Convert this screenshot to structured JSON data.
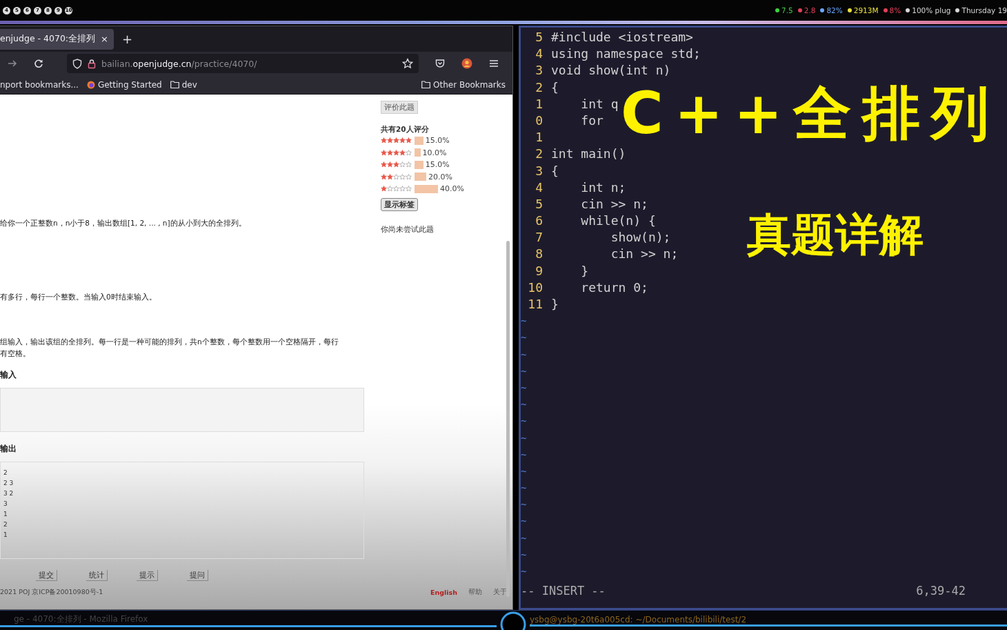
{
  "top_bar": {
    "workspaces": [
      "4",
      "5",
      "6",
      "7",
      "8",
      "9",
      "10"
    ],
    "status": [
      {
        "text": "7.5",
        "color": "#3fd13f"
      },
      {
        "text": "2.8",
        "color": "#e0405a"
      },
      {
        "text": "82%",
        "color": "#6aa8ff"
      },
      {
        "text": "2913M",
        "color": "#e8e040"
      },
      {
        "text": "8%",
        "color": "#e0405a"
      },
      {
        "text": "100% plug",
        "color": "#d8d8d8"
      },
      {
        "text": "Thursday 19",
        "color": "#d8d8d8"
      }
    ]
  },
  "browser": {
    "tab": {
      "title": "enjudge - 4070:全排列",
      "close": "×",
      "selected": true
    },
    "new_tab": "+",
    "url": {
      "host_prefix": "bailian.",
      "host": "openjudge.cn",
      "path": "/practice/4070/"
    },
    "bookmarks": [
      {
        "kind": "plain",
        "label": "nport bookmarks..."
      },
      {
        "kind": "firefox",
        "label": "Getting Started"
      },
      {
        "kind": "folder",
        "label": "dev"
      }
    ],
    "other_bookmarks": "Other Bookmarks",
    "problem": {
      "description": "给你一个正整数n，n小于8，输出数组[1, 2, ... , n]的从小到大的全排列。",
      "input": "有多行，每行一个整数。当输入0时结束输入。",
      "output": [
        "组输入，输出该组的全排列。每一行是一种可能的排列，共n个整数，每个整数用一个空格隔开，每行",
        "有空格。"
      ],
      "sample_input_heading": "输入",
      "sample_output_heading": "输出",
      "sample_output": [
        "2",
        "2 3",
        "3 2",
        "3",
        "1",
        "2",
        "1"
      ],
      "buttons": [
        "提交",
        "统计",
        "提示",
        "提问"
      ],
      "footer": "2021 POJ 京ICP备20010980号-1",
      "footer_links": [
        {
          "text": "English",
          "kind": "lang"
        },
        {
          "text": "帮助",
          "kind": "plain"
        },
        {
          "text": "关于",
          "kind": "plain"
        }
      ]
    },
    "sidebar": {
      "rate_button": "评价此题",
      "rating_title": "共有20人评分",
      "ratings": [
        {
          "stars": 5,
          "percent": "15.0%"
        },
        {
          "stars": 4,
          "percent": "10.0%"
        },
        {
          "stars": 3,
          "percent": "15.0%"
        },
        {
          "stars": 2,
          "percent": "20.0%"
        },
        {
          "stars": 1,
          "percent": "40.0%"
        }
      ],
      "tags_button": "显示标签",
      "status": "你尚未尝试此题"
    }
  },
  "editor": {
    "lines": [
      {
        "num": "5",
        "text": "#include <iostream>"
      },
      {
        "num": "4",
        "text": "using namespace std;"
      },
      {
        "num": "3",
        "text": "void show(int n)"
      },
      {
        "num": "2",
        "text": "{"
      },
      {
        "num": "1",
        "text": "    int q"
      },
      {
        "num": "0",
        "text": "    for"
      },
      {
        "num": "1"
      },
      {
        "num": "2",
        "text": "int main()"
      },
      {
        "num": "3",
        "text": "{"
      },
      {
        "num": "4",
        "text": "    int n;"
      },
      {
        "num": "5",
        "text": "    cin >> n;"
      },
      {
        "num": "6",
        "text": "    while(n) {"
      },
      {
        "num": "7",
        "text": "        show(n);"
      },
      {
        "num": "8",
        "text": "        cin >> n;"
      },
      {
        "num": "9",
        "text": "    }"
      },
      {
        "num": "10",
        "text": "    return 0;"
      },
      {
        "num": "11",
        "text": "}"
      }
    ],
    "tildes": [
      "~",
      "~",
      "~",
      "~",
      "~",
      "~",
      "~",
      "~",
      "~",
      "~",
      "~",
      "~",
      "~",
      "~",
      "~",
      "~"
    ],
    "mode": "-- INSERT --",
    "position": "6,39-42"
  },
  "overlay": {
    "title": "C++全排列",
    "subtitle": "真题详解"
  },
  "taskbar": {
    "left": "ge - 4070:全排列 - Mozilla Firefox",
    "right": "ysbg@ysbg-20t6a005cd: ~/Documents/bilibili/test/2"
  }
}
